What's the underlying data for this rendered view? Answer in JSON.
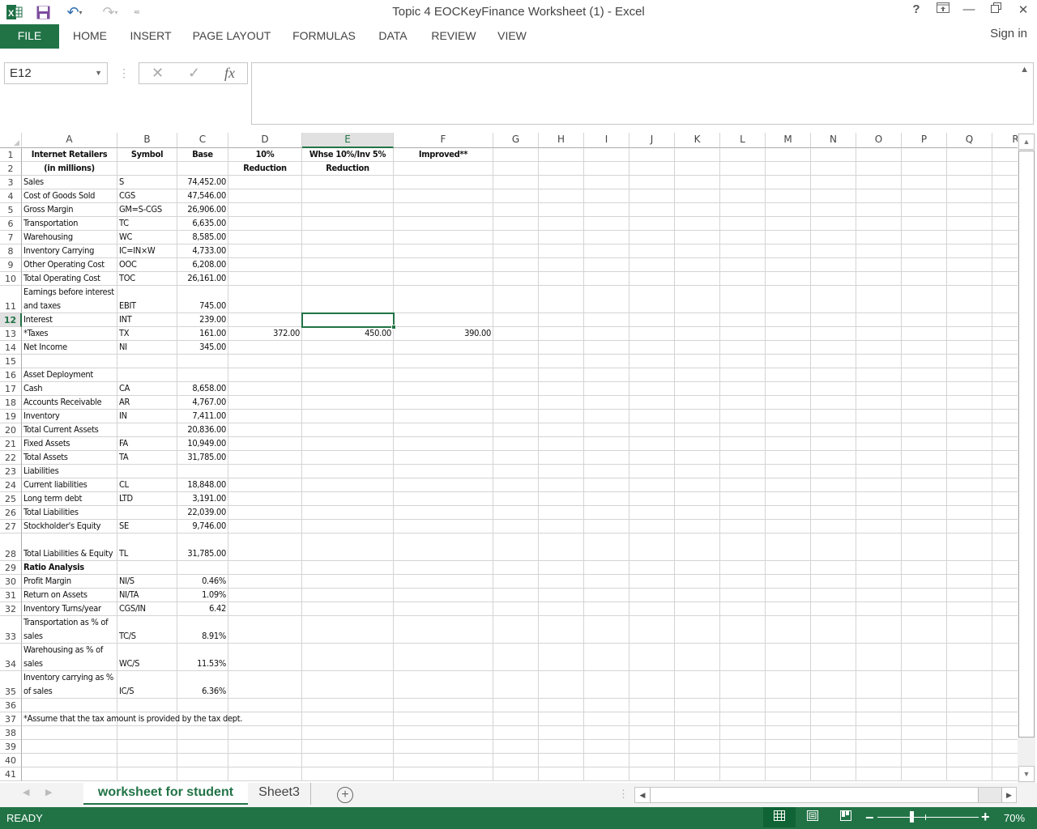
{
  "window": {
    "title": "Topic 4 EOCKeyFinance Worksheet (1) - Excel",
    "qat_icons": [
      "excel-logo-icon",
      "save-icon",
      "undo-icon",
      "redo-icon",
      "customize-qat-icon"
    ],
    "controls": {
      "help": "?",
      "ribbon_options": "⧉",
      "minimize": "—",
      "restore": "🗗",
      "close": "✕"
    }
  },
  "ribbon": {
    "tabs": [
      "FILE",
      "HOME",
      "INSERT",
      "PAGE LAYOUT",
      "FORMULAS",
      "DATA",
      "REVIEW",
      "VIEW"
    ],
    "sign_in": "Sign in"
  },
  "formula_bar": {
    "name_box": "E12",
    "cancel": "✕",
    "enter": "✓",
    "fx": "fx",
    "formula": ""
  },
  "sheet": {
    "columns": [
      "A",
      "B",
      "C",
      "D",
      "E",
      "F",
      "G",
      "H",
      "I",
      "J",
      "K",
      "L",
      "M",
      "N",
      "O",
      "P",
      "Q",
      "R"
    ],
    "selected_cell": "E12",
    "rows": [
      {
        "n": "1",
        "A": "Internet Retailers",
        "B": "Symbol",
        "C": "Base",
        "D": "10%",
        "E": "Whse 10%/Inv 5%",
        "F": "Improved**"
      },
      {
        "n": "2",
        "A": "(in millions)",
        "D": "Reduction",
        "E": "Reduction"
      },
      {
        "n": "3",
        "A": "Sales",
        "B": "S",
        "C": "74,452.00"
      },
      {
        "n": "4",
        "A": "Cost of Goods Sold",
        "B": "CGS",
        "C": "47,546.00"
      },
      {
        "n": "5",
        "A": "Gross Margin",
        "B": "GM=S-CGS",
        "C": "26,906.00"
      },
      {
        "n": "6",
        "A": "Transportation",
        "B": "TC",
        "C": "6,635.00"
      },
      {
        "n": "7",
        "A": "Warehousing",
        "B": "WC",
        "C": "8,585.00"
      },
      {
        "n": "8",
        "A": "Inventory Carrying",
        "B": "IC=IN×W",
        "C": "4,733.00"
      },
      {
        "n": "9",
        "A": "Other Operating Cost",
        "B": "OOC",
        "C": "6,208.00"
      },
      {
        "n": "10",
        "A": "Total Operating Cost",
        "B": "TOC",
        "C": "26,161.00"
      },
      {
        "n": "11",
        "A": "Earnings before interest and taxes",
        "B": "EBIT",
        "C": "745.00"
      },
      {
        "n": "12",
        "A": "Interest",
        "B": "INT",
        "C": "239.00"
      },
      {
        "n": "13",
        "A": "*Taxes",
        "B": "TX",
        "C": "161.00",
        "D": "372.00",
        "E": "450.00",
        "F": "390.00"
      },
      {
        "n": "14",
        "A": "Net Income",
        "B": "NI",
        "C": "345.00"
      },
      {
        "n": "15"
      },
      {
        "n": "16",
        "A": "Asset Deployment"
      },
      {
        "n": "17",
        "A": "Cash",
        "B": "CA",
        "C": "8,658.00"
      },
      {
        "n": "18",
        "A": "Accounts Receivable",
        "B": "AR",
        "C": "4,767.00"
      },
      {
        "n": "19",
        "A": "Inventory",
        "B": "IN",
        "C": "7,411.00"
      },
      {
        "n": "20",
        "A": "Total Current Assets",
        "C": "20,836.00"
      },
      {
        "n": "21",
        "A": "Fixed Assets",
        "B": "FA",
        "C": "10,949.00"
      },
      {
        "n": "22",
        "A": "Total Assets",
        "B": "TA",
        "C": "31,785.00"
      },
      {
        "n": "23",
        "A": "Liabilities"
      },
      {
        "n": "24",
        "A": "Current liabilities",
        "B": "CL",
        "C": "18,848.00"
      },
      {
        "n": "25",
        "A": "Long term debt",
        "B": "LTD",
        "C": "3,191.00"
      },
      {
        "n": "26",
        "A": "Total Liabilities",
        "C": "22,039.00"
      },
      {
        "n": "27",
        "A": "Stockholder's Equity",
        "B": "SE",
        "C": "9,746.00"
      },
      {
        "n": "28",
        "A": "Total Liabilities & Equity",
        "B": "TL",
        "C": "31,785.00"
      },
      {
        "n": "29",
        "A": "Ratio Analysis"
      },
      {
        "n": "30",
        "A": "Profit Margin",
        "B": "NI/S",
        "C": "0.46%"
      },
      {
        "n": "31",
        "A": "Return on Assets",
        "B": "NI/TA",
        "C": "1.09%"
      },
      {
        "n": "32",
        "A": "Inventory Turns/year",
        "B": "CGS/IN",
        "C": "6.42"
      },
      {
        "n": "33",
        "A": "Transportation as % of sales",
        "B": "TC/S",
        "C": "8.91%"
      },
      {
        "n": "34",
        "A": "Warehousing as % of sales",
        "B": "WC/S",
        "C": "11.53%"
      },
      {
        "n": "35",
        "A": "Inventory carrying as % of sales",
        "B": "IC/S",
        "C": "6.36%"
      },
      {
        "n": "36"
      },
      {
        "n": "37",
        "A": "*Assume that the tax amount is provided by the tax dept."
      },
      {
        "n": "38"
      },
      {
        "n": "39"
      },
      {
        "n": "40"
      },
      {
        "n": "41"
      }
    ]
  },
  "sheet_tabs": {
    "tabs": [
      "worksheet for student",
      "Sheet3"
    ],
    "active": "worksheet for student",
    "add_label": "+"
  },
  "status_bar": {
    "status": "READY",
    "zoom_level": "70%",
    "zoom_percent": 70,
    "views": [
      "normal-view-icon",
      "page-layout-view-icon",
      "page-break-preview-icon"
    ]
  },
  "colors": {
    "accent": "#217346",
    "selected_header_bg": "#e1e1e1",
    "gridline": "#d4d4d4"
  }
}
